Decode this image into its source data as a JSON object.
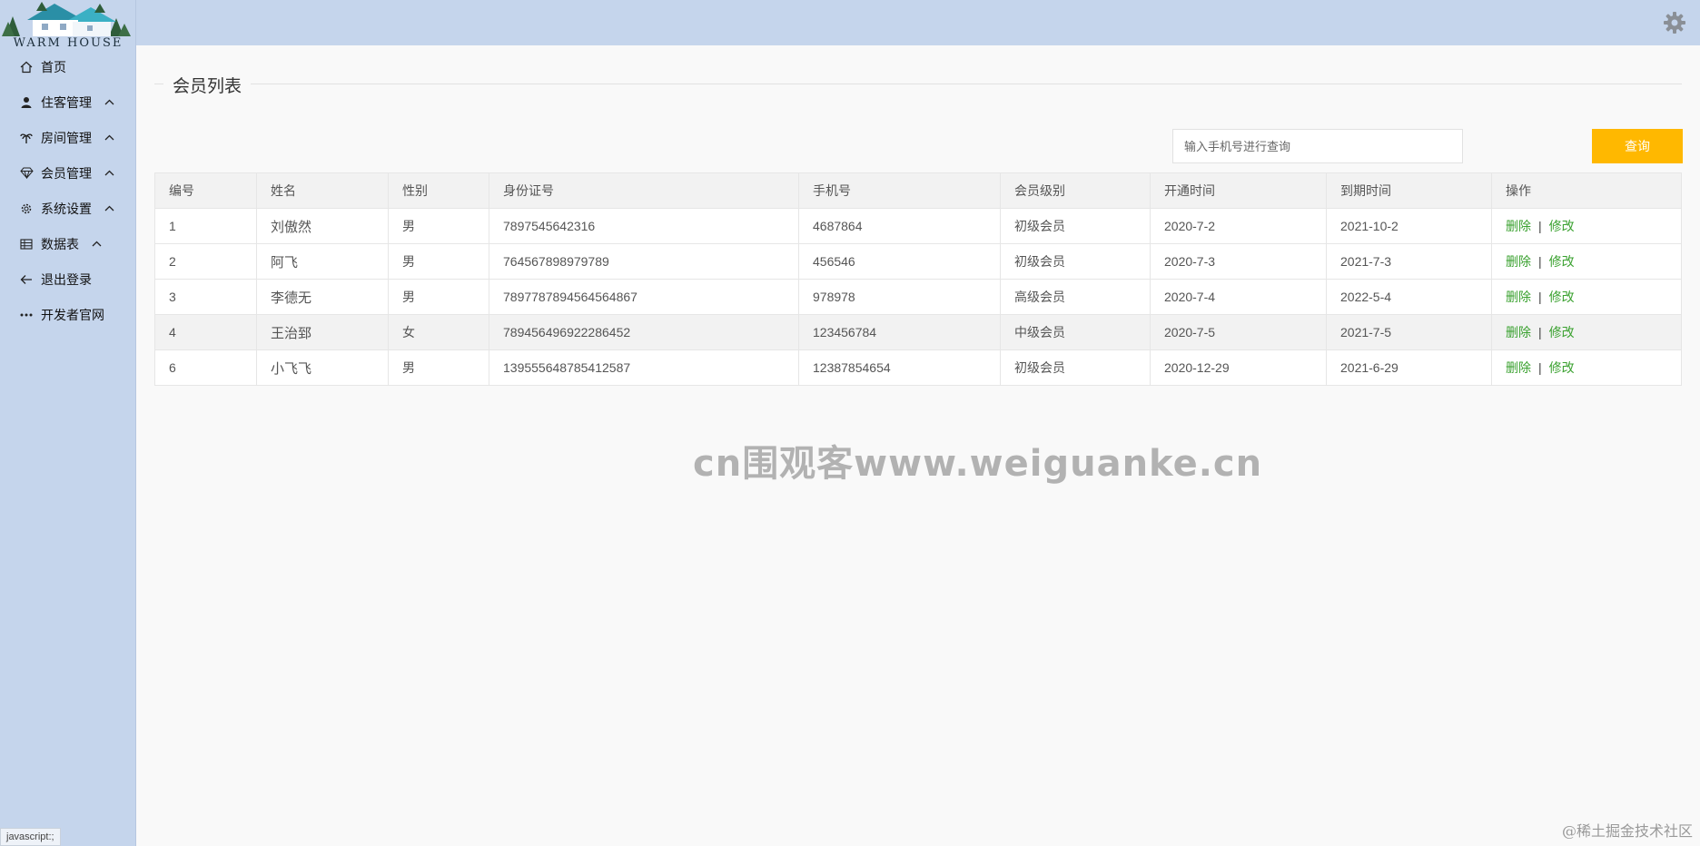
{
  "brand": {
    "logo_text": "WARM HOUSE"
  },
  "sidebar": {
    "items": [
      {
        "label": "首页",
        "icon": "home-icon",
        "has_chevron": false
      },
      {
        "label": "住客管理",
        "icon": "user-icon",
        "has_chevron": true
      },
      {
        "label": "房间管理",
        "icon": "palm-tree-icon",
        "has_chevron": true
      },
      {
        "label": "会员管理",
        "icon": "diamond-icon",
        "has_chevron": true
      },
      {
        "label": "系统设置",
        "icon": "gear-icon",
        "has_chevron": true
      },
      {
        "label": "数据表",
        "icon": "table-icon",
        "has_chevron": true
      },
      {
        "label": "退出登录",
        "icon": "arrow-left-icon",
        "has_chevron": false
      },
      {
        "label": "开发者官网",
        "icon": "more-icon",
        "has_chevron": false
      }
    ]
  },
  "status_tip": "javascript:;",
  "main": {
    "section_title": "会员列表",
    "search": {
      "placeholder": "输入手机号进行查询",
      "value": "",
      "button_label": "查询"
    },
    "table": {
      "headers": [
        "编号",
        "姓名",
        "性别",
        "身份证号",
        "手机号",
        "会员级别",
        "开通时间",
        "到期时间",
        "操作"
      ],
      "rows": [
        {
          "id": "1",
          "name": "刘傲然",
          "gender": "男",
          "id_card": "7897545642316",
          "phone": "4687864",
          "level": "初级会员",
          "level_color": "#1e3f8a",
          "start": "2020-7-2",
          "end": "2021-10-2"
        },
        {
          "id": "2",
          "name": "阿飞",
          "gender": "男",
          "id_card": "764567898979789",
          "phone": "456546",
          "level": "初级会员",
          "level_color": "#1e3f8a",
          "start": "2020-7-3",
          "end": "2021-7-3"
        },
        {
          "id": "3",
          "name": "李德无",
          "gender": "男",
          "id_card": "7897787894564564867",
          "phone": "978978",
          "level": "高级会员",
          "level_color": "#a12a2a",
          "start": "2020-7-4",
          "end": "2022-5-4"
        },
        {
          "id": "4",
          "name": "王治郅",
          "gender": "女",
          "id_card": "789456496922286452",
          "phone": "123456784",
          "level": "中级会员",
          "level_color": "#e8a735",
          "start": "2020-7-5",
          "end": "2021-7-5"
        },
        {
          "id": "6",
          "name": "小飞飞",
          "gender": "男",
          "id_card": "139555648785412587",
          "phone": "12387854654",
          "level": "初级会员",
          "level_color": "#1e3f8a",
          "start": "2020-12-29",
          "end": "2021-6-29"
        }
      ],
      "delete_label": "删除",
      "edit_label": "修改",
      "separator": "|"
    }
  },
  "watermark": "cn围观客www.weiguanke.cn",
  "corner_mark": "@稀土掘金技术社区",
  "colors": {
    "sidebar_bg": "#c5d5ec",
    "accent_button": "#ffb800",
    "action_link": "#3aa12f"
  }
}
